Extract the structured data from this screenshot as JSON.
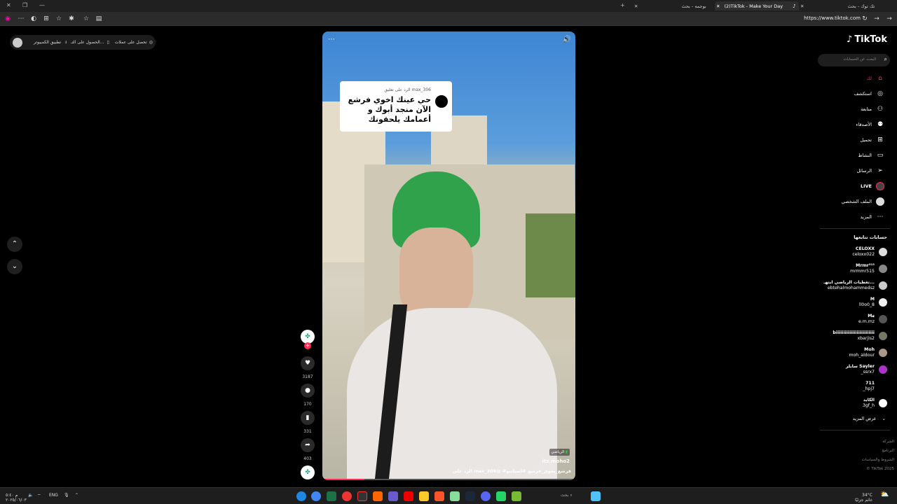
{
  "browser": {
    "tabs": [
      {
        "title": "تك توك - بحث"
      },
      {
        "title": "(2)TikTok - Make Your Day"
      },
      {
        "title": "بوجمه - بحث"
      }
    ],
    "url": "https://www.tiktok.com"
  },
  "top_bar": {
    "items": [
      "تحصل على عملات",
      "الحصول على التـ...",
      "تطبيق الكمبيوتر"
    ]
  },
  "video": {
    "comment_reply_label": "الرد على تعليق max_306",
    "comment_text": "حي عينك اخوي فرشع الآن منجد أبوك و أعمامك يلحقونك",
    "author_badge": "الرياضي",
    "author": "its.moho2",
    "caption": "الرد على max_306@  #فرشع_يخوي_فرشع #اسبانيو"
  },
  "actions": {
    "likes": "3187",
    "comments": "170",
    "saves": "331",
    "shares": "403"
  },
  "sidebar": {
    "logo": "TikTok",
    "search_placeholder": "البحث عن الحسابات",
    "nav": [
      {
        "label": "لك",
        "icon": "home-icon"
      },
      {
        "label": "استكشف",
        "icon": "compass-icon"
      },
      {
        "label": "متابعة",
        "icon": "user-follow-icon"
      },
      {
        "label": "الأصدقاء",
        "icon": "friends-icon"
      },
      {
        "label": "تحميل",
        "icon": "upload-icon"
      },
      {
        "label": "النشاط",
        "icon": "activity-icon"
      },
      {
        "label": "الرسائل",
        "icon": "messages-icon"
      },
      {
        "label": "LIVE",
        "icon": "live-icon"
      },
      {
        "label": "الملف الشخصي",
        "icon": "profile-icon"
      },
      {
        "label": "المزيد",
        "icon": "more-icon"
      }
    ],
    "following_title": "حسابات تتابعها",
    "following": [
      {
        "name": "CELOXX",
        "handle": "celoxx022"
      },
      {
        "name": "Mrmr⁵¹⁵",
        "handle": "mrmmr515"
      },
      {
        "name": "تغطيات الرياضي ابتهـ...",
        "handle": "ebtehalmohammedsz"
      },
      {
        "name": "M",
        "handle": "ll0o0_8"
      },
      {
        "name": "M𝓪",
        "handle": "e.m.mz"
      },
      {
        "name": "biiiiiiiiiiiiiiiiiiiiiiiiii",
        "handle": "xbarjis2"
      },
      {
        "name": "Moh",
        "handle": "moh_aldour"
      },
      {
        "name": "سايلر Sayler",
        "handle": "_ssrx7"
      },
      {
        "name": "711",
        "handle": "_hpj7"
      },
      {
        "name": "الكايد",
        "handle": "3gf_h"
      }
    ],
    "show_more": "عرض المزيد",
    "footer": [
      "الشركة",
      "البرنامج",
      "الشروط والسياسات",
      "© TikTok 2025"
    ]
  },
  "taskbar": {
    "lang": "ENG",
    "search_label": "بحث",
    "weather_temp": "34°C",
    "weather_desc": "غائم جزئيًا",
    "time": "م ٥:٤٠",
    "date": "٢٠٢٥/٠٦/٠٣"
  }
}
